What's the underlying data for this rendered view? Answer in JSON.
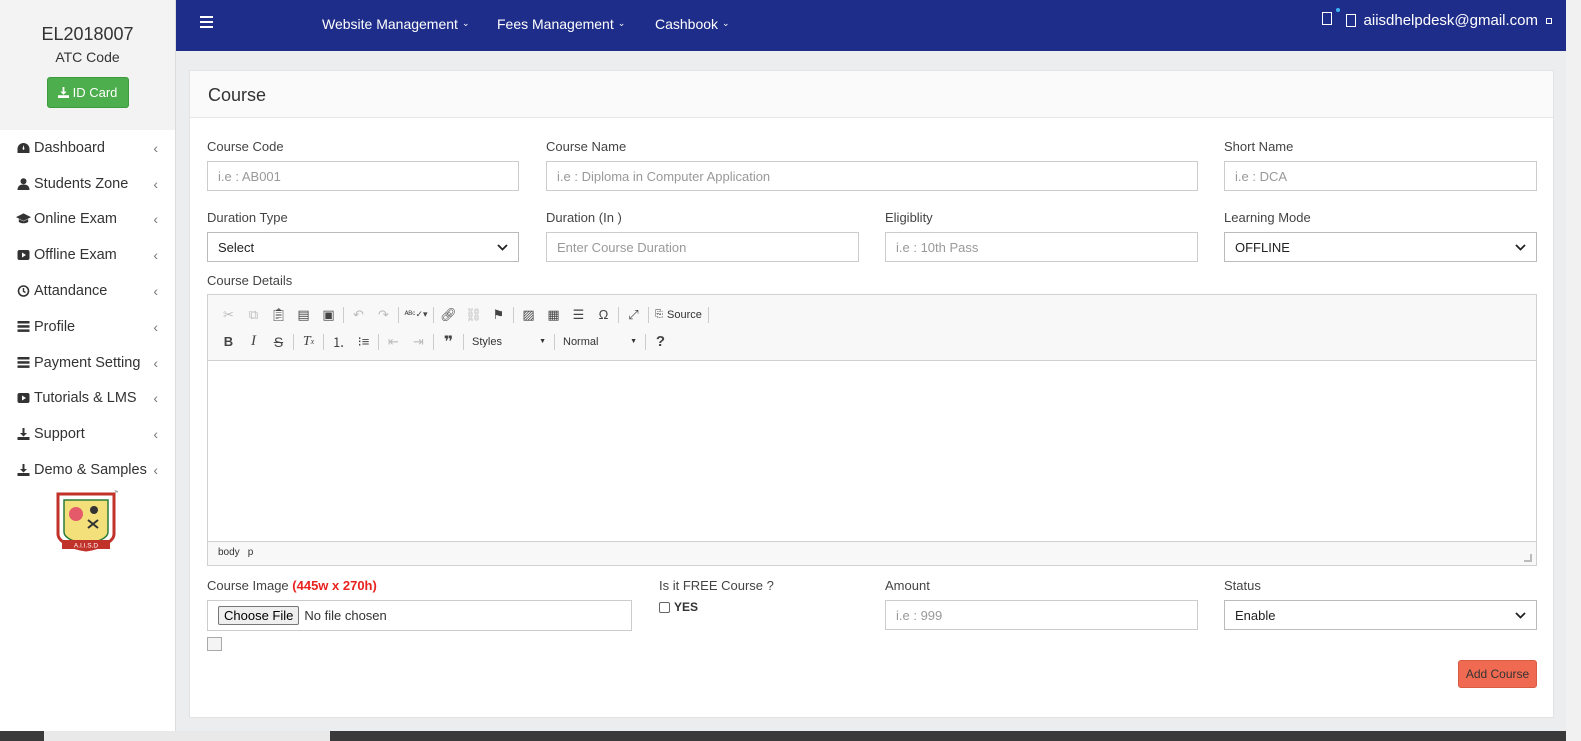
{
  "sidebar": {
    "code": "EL2018007",
    "atc_label": "ATC Code",
    "id_card_label": "ID Card",
    "items": [
      {
        "label": "Dashboard",
        "icon": "dashboard-icon"
      },
      {
        "label": "Students Zone",
        "icon": "user-icon"
      },
      {
        "label": "Online Exam",
        "icon": "graduation-cap-icon"
      },
      {
        "label": "Offline Exam",
        "icon": "play-icon"
      },
      {
        "label": "Attandance",
        "icon": "clock-icon"
      },
      {
        "label": "Profile",
        "icon": "list-icon"
      },
      {
        "label": "Payment Setting",
        "icon": "list-icon"
      },
      {
        "label": "Tutorials & LMS",
        "icon": "play-icon"
      },
      {
        "label": "Support",
        "icon": "download-icon"
      },
      {
        "label": "Demo & Samples",
        "icon": "download-icon"
      }
    ],
    "logo_text": "A.I.I.S.D"
  },
  "topbar": {
    "menus": [
      "Website Management",
      "Fees Management",
      "Cashbook"
    ],
    "email": "aiisdhelpdesk@gmail.com",
    "accent": "#1f2d8a"
  },
  "form": {
    "title": "Course",
    "course_code": {
      "label": "Course Code",
      "placeholder": "i.e : AB001"
    },
    "course_name": {
      "label": "Course Name",
      "placeholder": "i.e : Diploma in Computer Application"
    },
    "short_name": {
      "label": "Short Name",
      "placeholder": "i.e : DCA"
    },
    "duration_type": {
      "label": "Duration Type",
      "value": "Select"
    },
    "duration": {
      "label": "Duration (In )",
      "placeholder": "Enter Course Duration"
    },
    "eligibility": {
      "label": "Eligiblity",
      "placeholder": "i.e : 10th Pass"
    },
    "learning_mode": {
      "label": "Learning Mode",
      "value": "OFFLINE"
    },
    "course_details": {
      "label": "Course Details"
    },
    "editor": {
      "source_label": "Source",
      "styles_label": "Styles",
      "format_label": "Normal",
      "path": [
        "body",
        "p"
      ]
    },
    "course_image": {
      "label": "Course Image",
      "size_hint": "(445w x 270h)",
      "button": "Choose File",
      "status": "No file chosen"
    },
    "free_course": {
      "label": "Is it FREE Course ?",
      "option": "YES"
    },
    "amount": {
      "label": "Amount",
      "placeholder": "i.e : 999"
    },
    "status": {
      "label": "Status",
      "value": "Enable"
    },
    "submit_label": "Add Course"
  }
}
